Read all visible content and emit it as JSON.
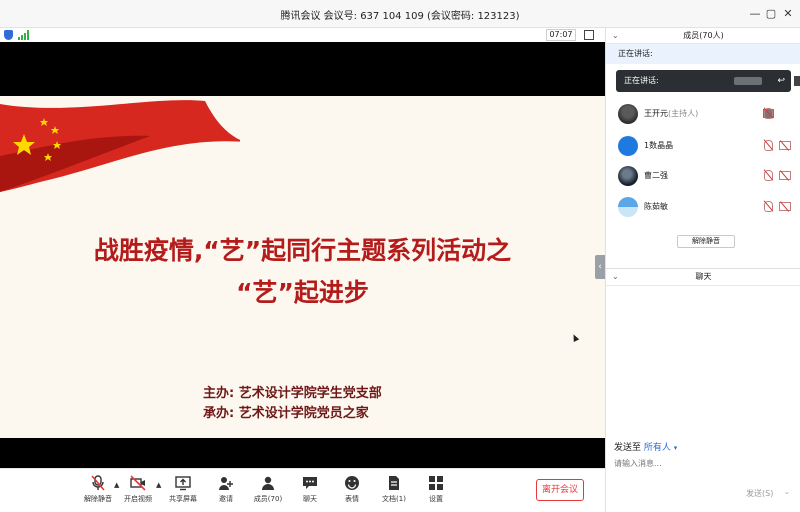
{
  "window": {
    "title": "腾讯会议 会议号: 637 104 109 (会议密码: 123123)",
    "controls": [
      "—",
      "▢",
      "✕"
    ]
  },
  "info_strip": {
    "timer": "07:07"
  },
  "slide": {
    "title_line1": "战胜疫情,“艺”起同行主题系列活动之",
    "title_line2": "“艺”起进步",
    "organizer": "主办: 艺术设计学院学生党支部",
    "co_organizer": "承办: 艺术设计学院党员之家"
  },
  "toolbar": {
    "items": [
      {
        "label": "解除静音",
        "icon": "mic-muted-icon"
      },
      {
        "label": "开启视频",
        "icon": "camera-off-icon"
      },
      {
        "label": "共享屏幕",
        "icon": "share-screen-icon"
      },
      {
        "label": "邀请",
        "icon": "invite-icon"
      },
      {
        "label": "成员(70)",
        "icon": "members-icon"
      },
      {
        "label": "聊天",
        "icon": "chat-icon"
      },
      {
        "label": "表情",
        "icon": "emoji-icon"
      },
      {
        "label": "文档(1)",
        "icon": "document-icon"
      },
      {
        "label": "设置",
        "icon": "settings-icon"
      }
    ],
    "leave_label": "离开会议",
    "accent": "#e33b3b"
  },
  "members_panel": {
    "header": "成员(70人)",
    "speaking_label": "正在讲话:",
    "popup_label": "正在讲话:",
    "members": [
      {
        "name": "王开元",
        "role": "(主持人)"
      },
      {
        "name": "1数晶晶",
        "role": ""
      },
      {
        "name": "曹二强",
        "role": ""
      },
      {
        "name": "陈茹敏",
        "role": ""
      }
    ],
    "unmute_all": "解除静音"
  },
  "chat_panel": {
    "header": "聊天",
    "send_to_label": "发送至",
    "send_to_target": "所有人",
    "input_placeholder": "请输入消息...",
    "send_label": "发送(S)"
  }
}
